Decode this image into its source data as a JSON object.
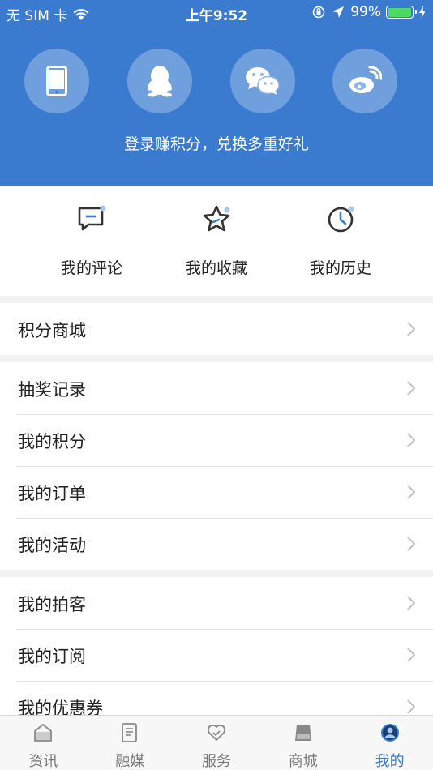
{
  "status_bar": {
    "carrier": "无 SIM 卡",
    "time": "上午9:52",
    "battery_percent": "99%",
    "battery_level": 0.99,
    "battery_color": "#4cd964"
  },
  "header": {
    "background": "#3a7bd0",
    "login_options": [
      {
        "name": "phone",
        "icon": "phone-icon"
      },
      {
        "name": "qq",
        "icon": "qq-icon"
      },
      {
        "name": "wechat",
        "icon": "wechat-icon"
      },
      {
        "name": "weibo",
        "icon": "weibo-icon"
      }
    ],
    "login_text": "登录赚积分，兑换多重好礼"
  },
  "quick_actions": [
    {
      "label": "我的评论",
      "icon": "comment-icon"
    },
    {
      "label": "我的收藏",
      "icon": "star-icon"
    },
    {
      "label": "我的历史",
      "icon": "clock-icon"
    }
  ],
  "menu_groups": [
    {
      "items": [
        "积分商城"
      ]
    },
    {
      "items": [
        "抽奖记录",
        "我的积分",
        "我的订单",
        "我的活动"
      ]
    },
    {
      "items": [
        "我的拍客",
        "我的订阅",
        "我的优惠券"
      ]
    }
  ],
  "tabbar": {
    "active_color": "#3a7bd0",
    "tabs": [
      {
        "label": "资讯",
        "icon": "home-icon",
        "active": false
      },
      {
        "label": "融媒",
        "icon": "document-icon",
        "active": false
      },
      {
        "label": "服务",
        "icon": "heart-icon",
        "active": false
      },
      {
        "label": "商城",
        "icon": "shop-icon",
        "active": false
      },
      {
        "label": "我的",
        "icon": "user-icon",
        "active": true
      }
    ]
  }
}
